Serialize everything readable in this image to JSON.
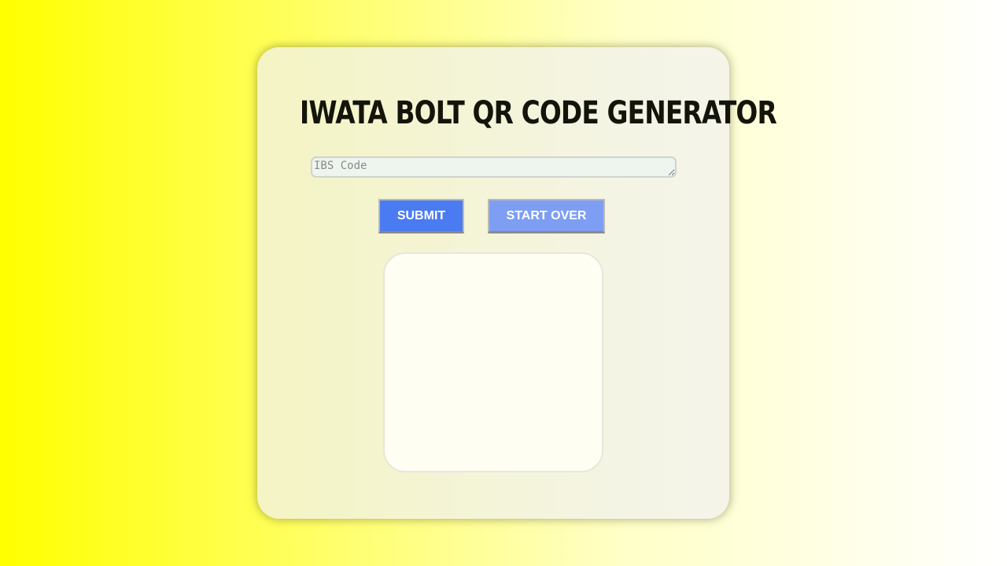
{
  "header": {
    "title": "IWATA BOLT QR CODE GENERATOR"
  },
  "form": {
    "code_placeholder": "IBS Code",
    "code_value": ""
  },
  "actions": {
    "submit_label": "SUBMIT",
    "start_over_label": "START OVER"
  },
  "colors": {
    "submit_button": "#4b7bf0",
    "start_over_button": "#7d9ef3",
    "background_start": "#ffff00",
    "background_end": "#ffffff"
  }
}
